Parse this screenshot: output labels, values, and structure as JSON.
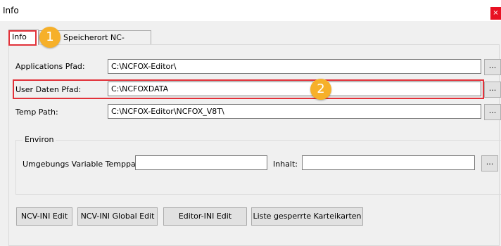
{
  "window": {
    "title": "Info",
    "close_glyph": "×"
  },
  "tabs": [
    {
      "label": "Info"
    },
    {
      "label": "Speicherort NC-Programme"
    }
  ],
  "fields": {
    "app_path": {
      "label": "Applications Pfad:",
      "value": "C:\\NCFOX-Editor\\"
    },
    "user_path": {
      "label": "User Daten Pfad:",
      "value": "C:\\NCFOXDATA"
    },
    "temp_path": {
      "label": "Temp Path:",
      "value": "C:\\NCFOX-Editor\\NCFOX_V8T\\"
    }
  },
  "environ": {
    "title": "Environ",
    "temppath_label": "Umgebungs Variable Temppath:",
    "temppath_value": "",
    "inhalt_label": "Inhalt:",
    "inhalt_value": ""
  },
  "browse_label": "...",
  "buttons": [
    {
      "label": "NCV-INI Edit"
    },
    {
      "label": "NCV-INI Global Edit"
    },
    {
      "label": "Editor-INI Edit"
    },
    {
      "label": "Liste gesperrte Karteikarten"
    }
  ],
  "annotations": {
    "marker1": "1",
    "marker2": "2"
  },
  "colors": {
    "highlight": "#e2323a",
    "marker": "#f6b02a",
    "close": "#e81123"
  }
}
